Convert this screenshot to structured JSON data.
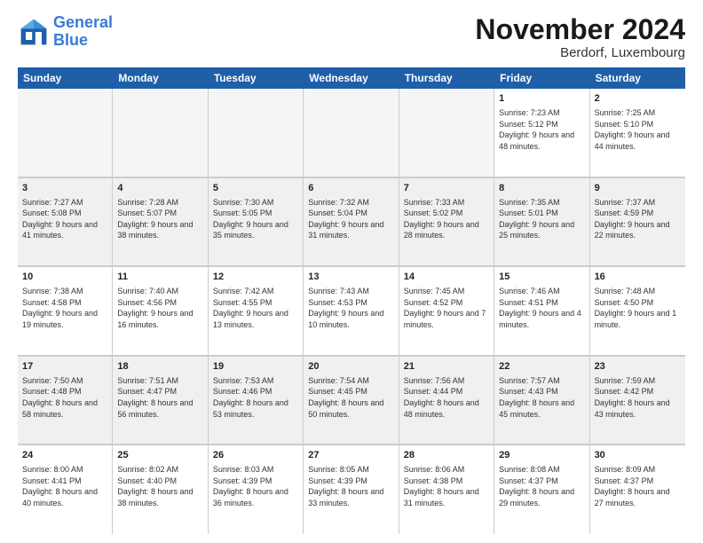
{
  "logo": {
    "line1": "General",
    "line2": "Blue"
  },
  "title": "November 2024",
  "location": "Berdorf, Luxembourg",
  "days": [
    "Sunday",
    "Monday",
    "Tuesday",
    "Wednesday",
    "Thursday",
    "Friday",
    "Saturday"
  ],
  "rows": [
    [
      {
        "day": "",
        "empty": true
      },
      {
        "day": "",
        "empty": true
      },
      {
        "day": "",
        "empty": true
      },
      {
        "day": "",
        "empty": true
      },
      {
        "day": "",
        "empty": true
      },
      {
        "day": "1",
        "info": "Sunrise: 7:23 AM\nSunset: 5:12 PM\nDaylight: 9 hours and 48 minutes."
      },
      {
        "day": "2",
        "info": "Sunrise: 7:25 AM\nSunset: 5:10 PM\nDaylight: 9 hours and 44 minutes."
      }
    ],
    [
      {
        "day": "3",
        "info": "Sunrise: 7:27 AM\nSunset: 5:08 PM\nDaylight: 9 hours and 41 minutes."
      },
      {
        "day": "4",
        "info": "Sunrise: 7:28 AM\nSunset: 5:07 PM\nDaylight: 9 hours and 38 minutes."
      },
      {
        "day": "5",
        "info": "Sunrise: 7:30 AM\nSunset: 5:05 PM\nDaylight: 9 hours and 35 minutes."
      },
      {
        "day": "6",
        "info": "Sunrise: 7:32 AM\nSunset: 5:04 PM\nDaylight: 9 hours and 31 minutes."
      },
      {
        "day": "7",
        "info": "Sunrise: 7:33 AM\nSunset: 5:02 PM\nDaylight: 9 hours and 28 minutes."
      },
      {
        "day": "8",
        "info": "Sunrise: 7:35 AM\nSunset: 5:01 PM\nDaylight: 9 hours and 25 minutes."
      },
      {
        "day": "9",
        "info": "Sunrise: 7:37 AM\nSunset: 4:59 PM\nDaylight: 9 hours and 22 minutes."
      }
    ],
    [
      {
        "day": "10",
        "info": "Sunrise: 7:38 AM\nSunset: 4:58 PM\nDaylight: 9 hours and 19 minutes."
      },
      {
        "day": "11",
        "info": "Sunrise: 7:40 AM\nSunset: 4:56 PM\nDaylight: 9 hours and 16 minutes."
      },
      {
        "day": "12",
        "info": "Sunrise: 7:42 AM\nSunset: 4:55 PM\nDaylight: 9 hours and 13 minutes."
      },
      {
        "day": "13",
        "info": "Sunrise: 7:43 AM\nSunset: 4:53 PM\nDaylight: 9 hours and 10 minutes."
      },
      {
        "day": "14",
        "info": "Sunrise: 7:45 AM\nSunset: 4:52 PM\nDaylight: 9 hours and 7 minutes."
      },
      {
        "day": "15",
        "info": "Sunrise: 7:46 AM\nSunset: 4:51 PM\nDaylight: 9 hours and 4 minutes."
      },
      {
        "day": "16",
        "info": "Sunrise: 7:48 AM\nSunset: 4:50 PM\nDaylight: 9 hours and 1 minute."
      }
    ],
    [
      {
        "day": "17",
        "info": "Sunrise: 7:50 AM\nSunset: 4:48 PM\nDaylight: 8 hours and 58 minutes."
      },
      {
        "day": "18",
        "info": "Sunrise: 7:51 AM\nSunset: 4:47 PM\nDaylight: 8 hours and 56 minutes."
      },
      {
        "day": "19",
        "info": "Sunrise: 7:53 AM\nSunset: 4:46 PM\nDaylight: 8 hours and 53 minutes."
      },
      {
        "day": "20",
        "info": "Sunrise: 7:54 AM\nSunset: 4:45 PM\nDaylight: 8 hours and 50 minutes."
      },
      {
        "day": "21",
        "info": "Sunrise: 7:56 AM\nSunset: 4:44 PM\nDaylight: 8 hours and 48 minutes."
      },
      {
        "day": "22",
        "info": "Sunrise: 7:57 AM\nSunset: 4:43 PM\nDaylight: 8 hours and 45 minutes."
      },
      {
        "day": "23",
        "info": "Sunrise: 7:59 AM\nSunset: 4:42 PM\nDaylight: 8 hours and 43 minutes."
      }
    ],
    [
      {
        "day": "24",
        "info": "Sunrise: 8:00 AM\nSunset: 4:41 PM\nDaylight: 8 hours and 40 minutes."
      },
      {
        "day": "25",
        "info": "Sunrise: 8:02 AM\nSunset: 4:40 PM\nDaylight: 8 hours and 38 minutes."
      },
      {
        "day": "26",
        "info": "Sunrise: 8:03 AM\nSunset: 4:39 PM\nDaylight: 8 hours and 36 minutes."
      },
      {
        "day": "27",
        "info": "Sunrise: 8:05 AM\nSunset: 4:39 PM\nDaylight: 8 hours and 33 minutes."
      },
      {
        "day": "28",
        "info": "Sunrise: 8:06 AM\nSunset: 4:38 PM\nDaylight: 8 hours and 31 minutes."
      },
      {
        "day": "29",
        "info": "Sunrise: 8:08 AM\nSunset: 4:37 PM\nDaylight: 8 hours and 29 minutes."
      },
      {
        "day": "30",
        "info": "Sunrise: 8:09 AM\nSunset: 4:37 PM\nDaylight: 8 hours and 27 minutes."
      }
    ]
  ]
}
